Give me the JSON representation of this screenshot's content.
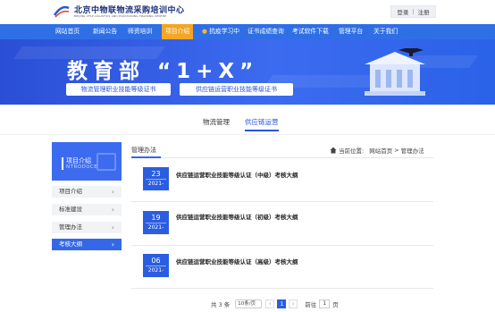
{
  "header": {
    "logo_text": "北京中物联物流采购培训中心",
    "logo_sub": "BEIJING CFLP LOGISTICS AND PURCHASING TRAINING CENTRE",
    "logo_badge": "CLPP",
    "login": "登录",
    "register": "注册",
    "sep": "|"
  },
  "nav": {
    "items": [
      "网站首页",
      "新闻公告",
      "师资培训",
      "项目介绍",
      "抗疫学习中",
      "证书成绩查询",
      "考试软件下载",
      "管理平台",
      "关于我们"
    ]
  },
  "banner": {
    "title": "教育部 “1+X”",
    "cert1": "物流管理职业技能等级证书",
    "cert2": "供应链运营职业技能等级证书"
  },
  "subtabs": [
    "物流管理",
    "供应链运营"
  ],
  "sidebar": {
    "head_title": "项目介绍",
    "head_en": "NTRODUCE",
    "items": [
      "项目介绍",
      "标准建设",
      "管理办法",
      "考核大纲"
    ]
  },
  "content": {
    "title": "管理办法",
    "crumb_label": "当前位置:",
    "crumb_home": "网站首页",
    "crumb_arrow": ">",
    "crumb_current": "管理办法"
  },
  "articles": [
    {
      "day": "23",
      "ym": "2021-",
      "title": "供应链运营职业技能等级认证（中级）考核大纲"
    },
    {
      "day": "19",
      "ym": "2021-",
      "title": "供应链运营职业技能等级认证（初级）考核大纲"
    },
    {
      "day": "06",
      "ym": "2021-",
      "title": "供应链运营职业技能等级认证（高级）考核大纲"
    }
  ],
  "pager": {
    "total": "共 3 条",
    "per_page": "10条/页",
    "prev": "‹",
    "current": "1",
    "next": "›",
    "goto": "前往",
    "goto_value": "1",
    "page_unit": "页"
  }
}
